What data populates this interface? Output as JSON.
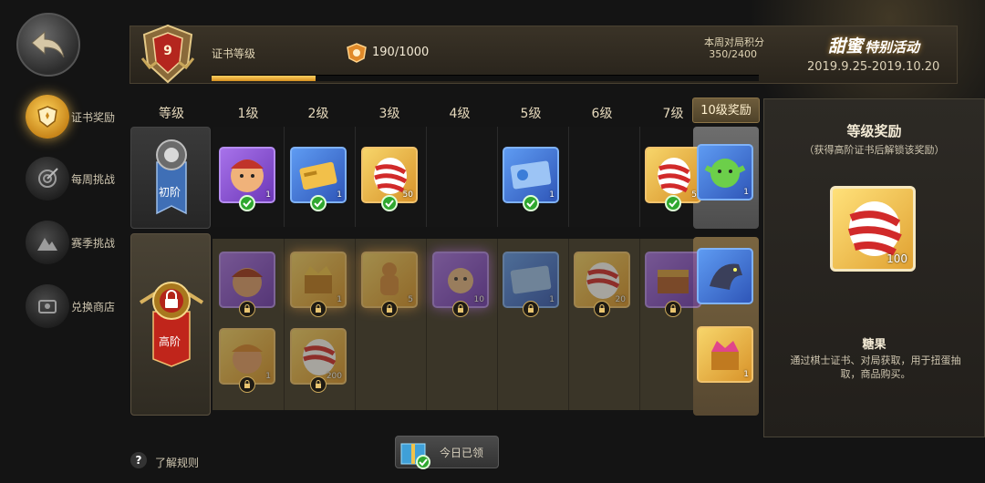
{
  "nav": {
    "items": [
      {
        "label": "证书奖励",
        "icon": "certificate-shield-icon",
        "active": true
      },
      {
        "label": "每周挑战",
        "icon": "target-icon",
        "active": false
      },
      {
        "label": "赛季挑战",
        "icon": "mountain-icon",
        "active": false
      },
      {
        "label": "兑换商店",
        "icon": "scroll-icon",
        "active": false
      }
    ]
  },
  "header": {
    "level": "9",
    "level_label": "证书等级",
    "xp": "190/1000",
    "xp_progress": 0.19,
    "week_label": "本周对局积分",
    "week_value": "350/2400",
    "event_title": "甜蜜",
    "event_title_sub": "特别活动",
    "event_dates": "2019.9.25-2019.10.20"
  },
  "grid": {
    "level_header": "等级",
    "columns": [
      "1级",
      "2级",
      "3级",
      "4级",
      "5级",
      "6级",
      "7级"
    ],
    "top_reward_header": "10级奖励",
    "basic_label": "初阶",
    "advanced_label": "高阶",
    "basic_counts": [
      "1",
      "1",
      "50",
      "",
      "1",
      "",
      "5"
    ],
    "top_basic_count": "1",
    "advanced_counts": [
      "",
      "1",
      "5",
      "10",
      "1",
      "20",
      ""
    ],
    "advanced_row2_counts": [
      "1",
      "200"
    ],
    "top_advanced_count": "1"
  },
  "panel": {
    "title": "等级奖励",
    "subtitle": "（获得高阶证书后解锁该奖励）",
    "item_count": "100",
    "item_name": "糖果",
    "description": "通过棋士证书、对局获取，用于扭蛋抽取，商品购买。"
  },
  "footer": {
    "help_label": "了解规则",
    "daily_label": "今日已领"
  }
}
